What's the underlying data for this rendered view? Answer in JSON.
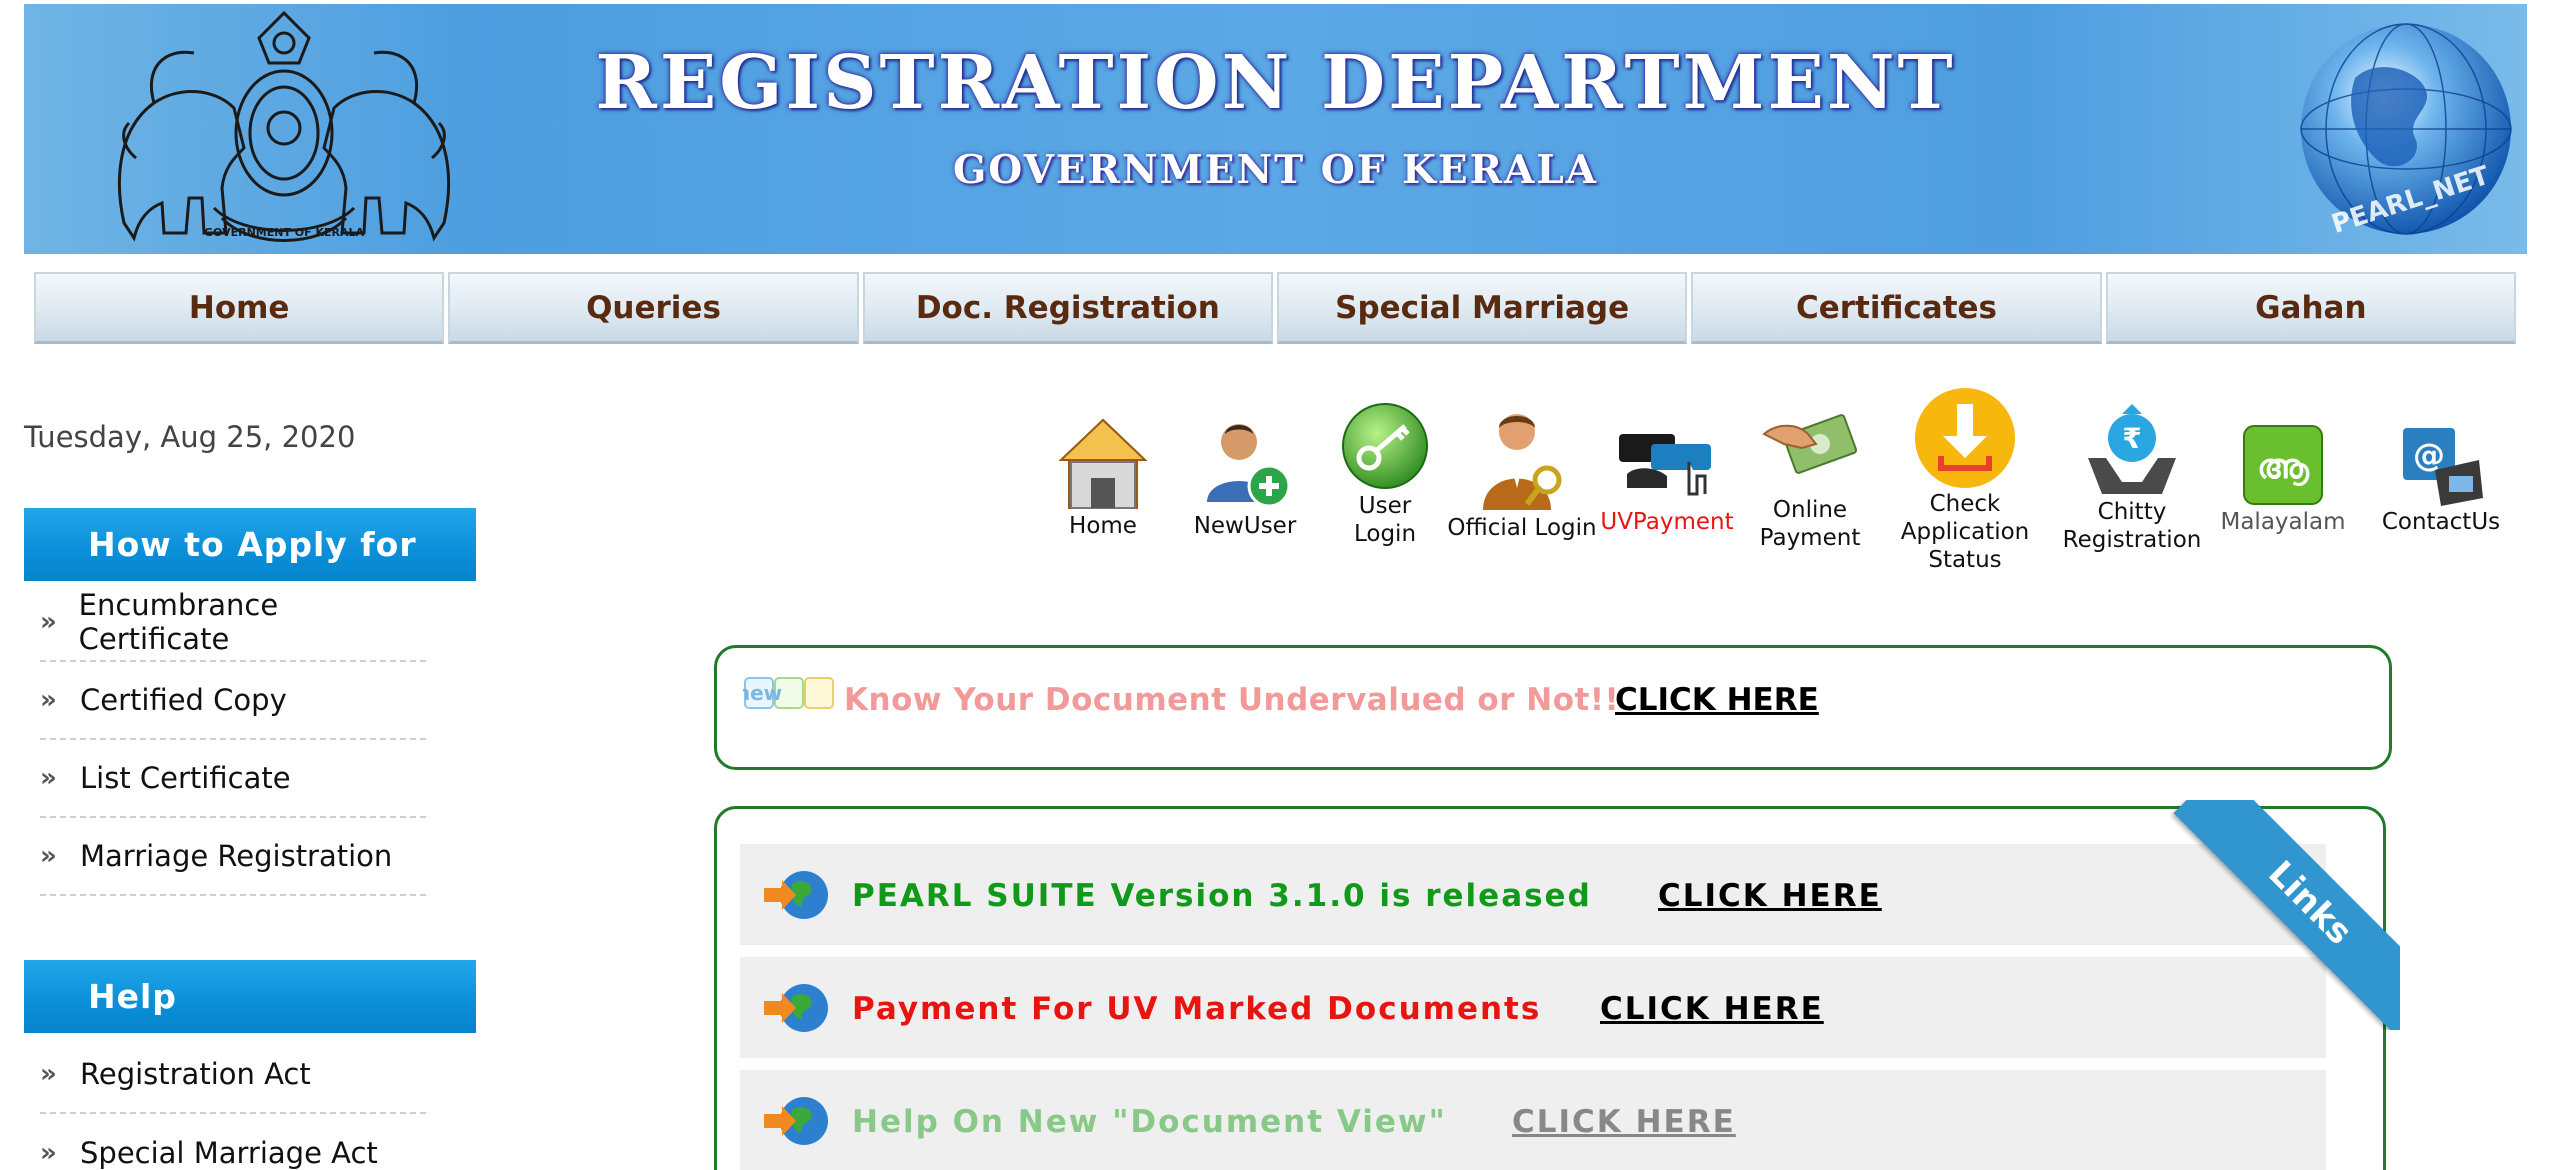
{
  "header": {
    "title": "REGISTRATION DEPARTMENT",
    "subtitle": "GOVERNMENT OF KERALA",
    "emblem_icon": "kerala-emblem-icon",
    "globe_icon": "pearl-net-globe-icon",
    "globe_text": "PEARL_NET"
  },
  "nav": {
    "items": [
      "Home",
      "Queries",
      "Doc. Registration",
      "Special Marriage",
      "Certificates",
      "Gahan"
    ]
  },
  "date": "Tuesday, Aug 25, 2020",
  "sidebar": {
    "apply": {
      "title": "How to Apply for",
      "items": [
        "Encumbrance Certificate",
        "Certified Copy",
        "List Certificate",
        "Marriage Registration"
      ]
    },
    "help": {
      "title": "Help",
      "items": [
        "Registration Act",
        "Special Marriage Act"
      ]
    }
  },
  "quick_links": {
    "home": "Home",
    "newuser": "NewUser",
    "user_login_1": "User",
    "user_login_2": "Login",
    "official_login": "Official Login",
    "uvpayment": "UVPayment",
    "online_payment_1": "Online",
    "online_payment_2": "Payment",
    "check_1": "Check",
    "check_2": "Application",
    "check_3": "Status",
    "chitty_1": "Chitty",
    "chitty_2": "Registration",
    "malayalam": "Malayalam",
    "malayalam_glyph": "ആ",
    "contactus": "ContactUs"
  },
  "undervalued": {
    "badge": "new",
    "text": "Know Your Document Undervalued or Not!!",
    "link": "CLICK HERE"
  },
  "links_box": {
    "ribbon": "Links",
    "rows": [
      {
        "text": "PEARL SUITE Version 3.1.0 is released",
        "link": "CLICK HERE"
      },
      {
        "text": "Payment For UV Marked Documents",
        "link": "CLICK HERE"
      },
      {
        "text": "Help On New \"Document View\"",
        "link": "CLICK HERE"
      }
    ]
  },
  "colors": {
    "nav_text": "#5a2a10",
    "sidebar_head": "#0a8fd8",
    "box_border": "#1f7a2a",
    "row1_text": "#119a1a",
    "row2_text": "#e8140f",
    "row3_text": "#88c888",
    "row3_link": "#888888",
    "uvpayment_text": "#e81414",
    "undervalued_text": "#f29a9a"
  }
}
